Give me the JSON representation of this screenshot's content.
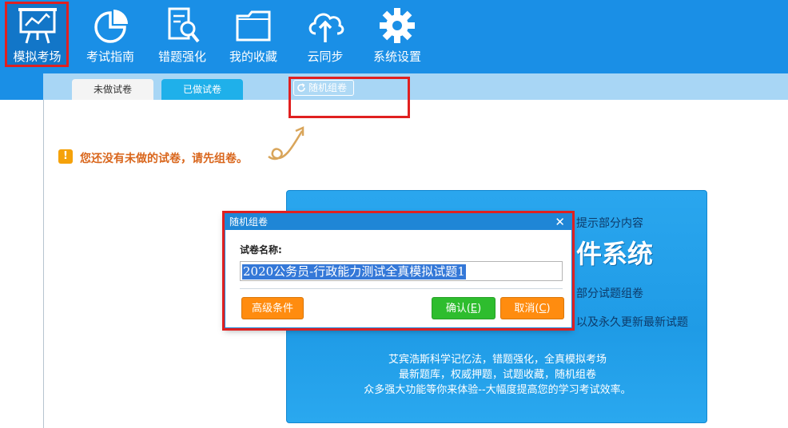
{
  "toolbar": {
    "items": [
      {
        "label": "模拟考场",
        "icon": "whiteboard-chart-icon",
        "active": true
      },
      {
        "label": "考试指南",
        "icon": "pie-chart-icon"
      },
      {
        "label": "错题强化",
        "icon": "document-magnifier-icon"
      },
      {
        "label": "我的收藏",
        "icon": "folder-icon"
      },
      {
        "label": "云同步",
        "icon": "cloud-upload-icon"
      },
      {
        "label": "系统设置",
        "icon": "gear-icon"
      }
    ]
  },
  "subtabs": {
    "undone": "未做试卷",
    "done": "已做试卷",
    "random": "随机组卷"
  },
  "hint": {
    "text": "您还没有未做的试卷，请先组卷。",
    "icon": "warning-icon"
  },
  "promo": {
    "line1": "提示部分内容",
    "line2": "件系统",
    "line3": "部分试题组卷",
    "line4": "以及永久更新最新试题",
    "footer1": "艾宾浩斯科学记忆法，错题强化，全真模拟考场",
    "footer2": "最新题库，权威押题，试题收藏，随机组卷",
    "footer3": "众多强大功能等你来体验--大幅度提高您的学习考试效率。"
  },
  "dialog": {
    "title": "随机组卷",
    "close": "✕",
    "name_label": "试卷名称:",
    "name_value": "2020公务员-行政能力测试全真模拟试题1",
    "advanced": "高级条件",
    "ok_text": "确认(",
    "ok_key": "E",
    "ok_end": ")",
    "cancel_text": "取消(",
    "cancel_key": "C",
    "cancel_end": ")"
  },
  "colors": {
    "toolbar": "#1a8fe6",
    "highlight": "#e02020",
    "orange": "#ff8c0f",
    "green": "#2ebd2e",
    "hint": "#d9661c"
  }
}
